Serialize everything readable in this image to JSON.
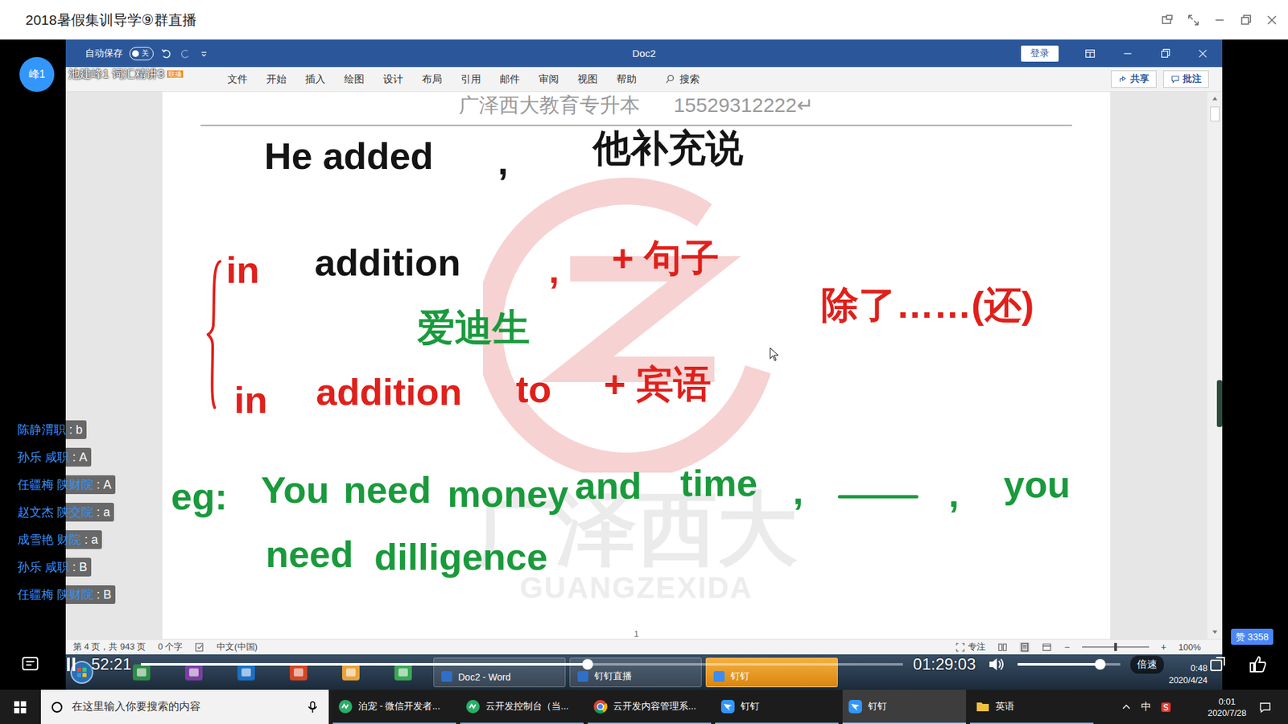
{
  "window": {
    "title": "2018暑假集训导学⑨群直播"
  },
  "presenter": {
    "avatar": "峰1",
    "name": "池建峰1 词汇精讲3",
    "badge": "联播"
  },
  "word": {
    "autosave": {
      "label": "自动保存",
      "state": "关",
      "on": false
    },
    "title": "Doc2",
    "login": "登录",
    "tabs": [
      {
        "label": "文件",
        "selected": false
      },
      {
        "label": "开始",
        "selected": false
      },
      {
        "label": "插入",
        "selected": false
      },
      {
        "label": "绘图",
        "selected": false
      },
      {
        "label": "设计",
        "selected": false
      },
      {
        "label": "布局",
        "selected": false
      },
      {
        "label": "引用",
        "selected": false
      },
      {
        "label": "邮件",
        "selected": false
      },
      {
        "label": "审阅",
        "selected": false
      },
      {
        "label": "视图",
        "selected": false
      },
      {
        "label": "帮助",
        "selected": false
      }
    ],
    "search": "搜索",
    "share": "共享",
    "comment": "批注",
    "header": "广泽西大教育专升本      15529312222↵",
    "ink": [
      {
        "kind": "text",
        "text": "He added",
        "color": "#141414"
      },
      {
        "kind": "text",
        "text": ",",
        "color": "#141414"
      },
      {
        "kind": "text",
        "text": "他补充说",
        "color": "#141414"
      },
      {
        "kind": "text",
        "text": "in",
        "color": "#e0201b"
      },
      {
        "kind": "text",
        "text": "addition",
        "color": "#141414"
      },
      {
        "kind": "text",
        "text": ",",
        "color": "#e0201b"
      },
      {
        "kind": "text",
        "text": "+ 句子",
        "color": "#e0201b"
      },
      {
        "kind": "text",
        "text": "爱迪生",
        "color": "#1a9a3c"
      },
      {
        "kind": "text",
        "text": "除了……(还)",
        "color": "#e0201b"
      },
      {
        "kind": "text",
        "text": "in",
        "color": "#e0201b"
      },
      {
        "kind": "text",
        "text": "addition",
        "color": "#e0201b"
      },
      {
        "kind": "text",
        "text": "to",
        "color": "#e0201b"
      },
      {
        "kind": "text",
        "text": "+ 宾语",
        "color": "#e0201b"
      },
      {
        "kind": "text",
        "text": "eg:",
        "color": "#1a9a3c"
      },
      {
        "kind": "text",
        "text": "You",
        "color": "#1a9a3c"
      },
      {
        "kind": "text",
        "text": "need",
        "color": "#1a9a3c"
      },
      {
        "kind": "text",
        "text": "money",
        "color": "#1a9a3c"
      },
      {
        "kind": "text",
        "text": "and",
        "color": "#1a9a3c"
      },
      {
        "kind": "text",
        "text": "time",
        "color": "#1a9a3c"
      },
      {
        "kind": "text",
        "text": ",",
        "color": "#1a9a3c"
      },
      {
        "kind": "stroke",
        "color": "#1a9a3c"
      },
      {
        "kind": "text",
        "text": ",",
        "color": "#1a9a3c"
      },
      {
        "kind": "text",
        "text": "you",
        "color": "#1a9a3c"
      },
      {
        "kind": "text",
        "text": "need",
        "color": "#1a9a3c"
      },
      {
        "kind": "text",
        "text": "dilligence",
        "color": "#1a9a3c"
      }
    ],
    "watermark": {
      "title": "广泽西大",
      "subtitle": "GUANGZEXIDA"
    },
    "page_number": "1",
    "status": {
      "page": "第 4 页，共 943 页",
      "words": "0 个字",
      "language": "中文(中国)",
      "focus": "专注",
      "zoom_out": "−",
      "zoom_in": "+",
      "zoom": "100%",
      "zoom_level": 0.5
    }
  },
  "video_taskbar": {
    "items": [
      {
        "label": "Doc2 - Word",
        "active": false
      },
      {
        "label": "钉钉直播",
        "active": false
      },
      {
        "label": "钉钉",
        "active": true
      }
    ],
    "time": "0:48",
    "date": "2020/4/24"
  },
  "player": {
    "playing": true,
    "elapsed": "52:21",
    "duration": "01:29:03",
    "progress": {
      "level": 0.586
    },
    "volume": {
      "level": 0.8
    },
    "speed": "倍速",
    "likes": "赞 3358"
  },
  "chat": [
    {
      "name": "陈静渭职",
      "message": ": b"
    },
    {
      "name": "孙乐 咸职",
      "message": ": A"
    },
    {
      "name": "任疆梅 陕财院",
      "message": ": A"
    },
    {
      "name": "赵文杰 陕交院",
      "message": ": a"
    },
    {
      "name": "成雪艳 财院",
      "message": ": a"
    },
    {
      "name": "孙乐 咸职",
      "message": ": B"
    },
    {
      "name": "任疆梅 陕财院",
      "message": ": B"
    }
  ],
  "taskbar": {
    "search_placeholder": "在这里输入你要搜索的内容",
    "apps": [
      {
        "label": "泊宠 - 微信开发者...",
        "selected": false
      },
      {
        "label": "云开发控制台（当...",
        "selected": false
      },
      {
        "label": "云开发内容管理系...",
        "selected": false
      },
      {
        "label": "钉钉",
        "selected": false
      },
      {
        "label": "钉钉",
        "selected": true
      },
      {
        "label": "英语",
        "selected": false
      }
    ],
    "tray": {
      "ime": "中",
      "time": "0:01",
      "date": "2020/7/28"
    }
  }
}
